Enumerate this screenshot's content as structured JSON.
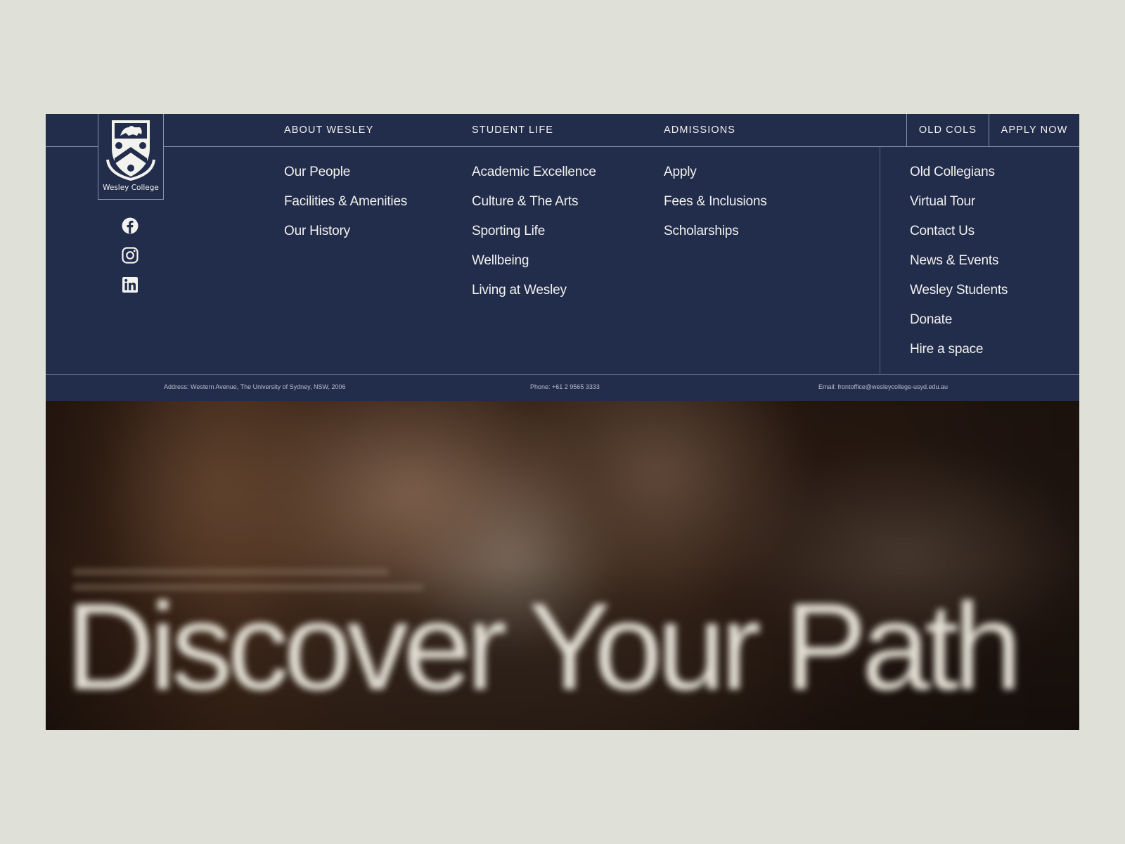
{
  "brand": {
    "name": "Wesley College"
  },
  "nav": {
    "links": [
      "ABOUT WESLEY",
      "STUDENT LIFE",
      "ADMISSIONS"
    ],
    "old_cols": "OLD COLS",
    "apply_now": "APPLY NOW"
  },
  "social": [
    "facebook-icon",
    "instagram-icon",
    "linkedin-icon"
  ],
  "menu": {
    "about": [
      "Our People",
      "Facilities & Amenities",
      "Our History"
    ],
    "student_life": [
      "Academic Excellence",
      "Culture & The Arts",
      "Sporting Life",
      "Wellbeing",
      "Living at Wesley"
    ],
    "admissions": [
      "Apply",
      "Fees & Inclusions",
      "Scholarships"
    ],
    "quick": [
      "Old Collegians",
      "Virtual Tour",
      "Contact Us",
      "News & Events",
      "Wesley Students",
      "Donate",
      "Hire a space"
    ]
  },
  "contact": {
    "address": "Address: Western Avenue, The University of Sydney, NSW, 2006",
    "phone": "Phone: +61 2 9565 3333",
    "email": "Email: frontoffice@wesleycollege-usyd.edu.au"
  },
  "hero": {
    "title": "Discover Your Path"
  },
  "colors": {
    "navy": "#222c4b",
    "background": "#dfe0d8",
    "text": "#f2f2ee"
  }
}
